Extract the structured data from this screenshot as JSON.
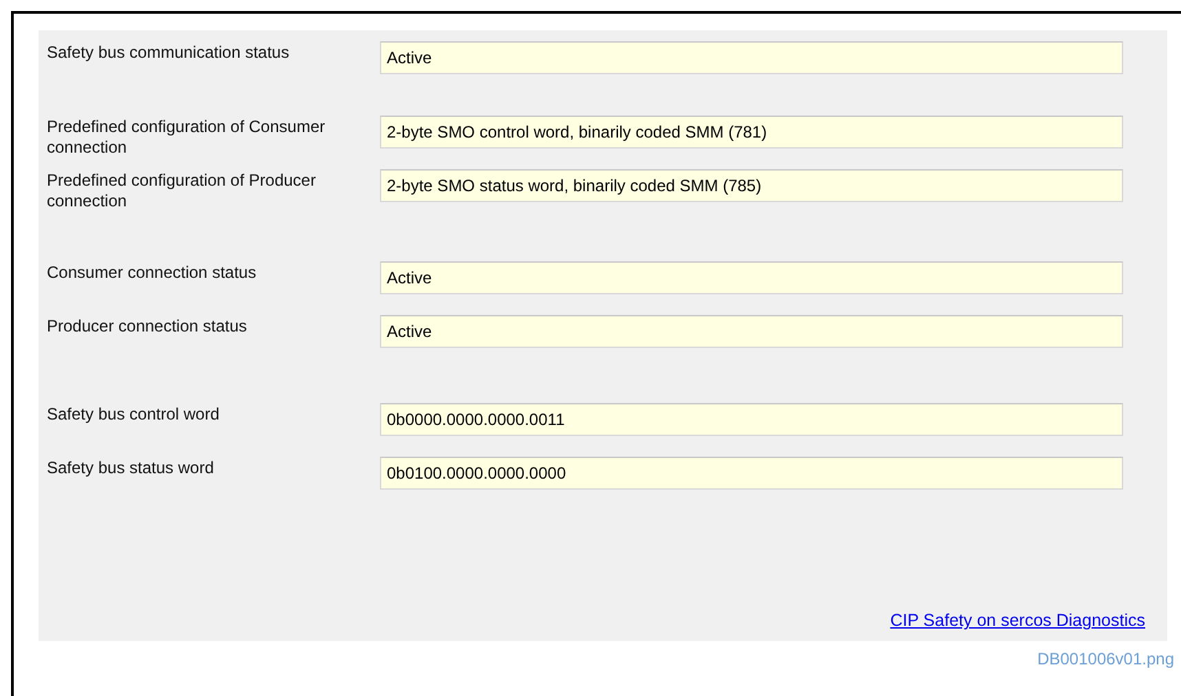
{
  "groups": [
    {
      "rows": [
        {
          "label": "Safety bus communication status",
          "value": "Active"
        }
      ]
    },
    {
      "rows": [
        {
          "label": "Predefined configuration of Consumer connection",
          "value": "2-byte SMO control word, binarily coded SMM (781)"
        },
        {
          "label": "Predefined configuration of Producer connection",
          "value": "2-byte SMO status word, binarily coded SMM (785)"
        }
      ]
    },
    {
      "rows": [
        {
          "label": "Consumer connection status",
          "value": "Active"
        },
        {
          "label": "Producer connection status",
          "value": "Active"
        }
      ]
    },
    {
      "rows": [
        {
          "label": "Safety bus control word",
          "value": "0b0000.0000.0000.0011"
        },
        {
          "label": "Safety bus status word",
          "value": "0b0100.0000.0000.0000"
        }
      ]
    }
  ],
  "link": "CIP Safety on sercos Diagnostics",
  "caption": "DB001006v01.png"
}
